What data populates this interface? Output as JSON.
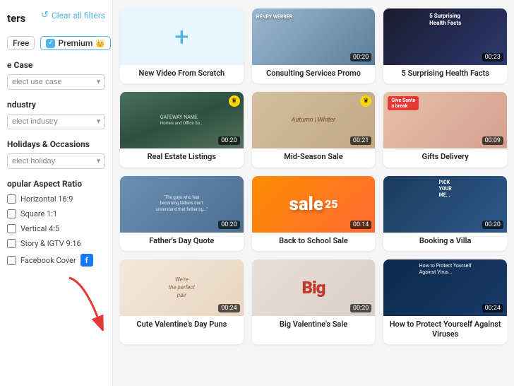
{
  "sidebar": {
    "title": "ters",
    "clear_filters_label": "Clear all filters",
    "free_label": "Free",
    "premium_label": "Premium",
    "use_case_label": "e Case",
    "use_case_placeholder": "elect use case",
    "industry_label": "ndustry",
    "industry_placeholder": "elect industry",
    "holidays_label": "Holidays & Occasions",
    "holidays_placeholder": "elect holiday",
    "aspect_ratio_label": "opular Aspect Ratio",
    "aspect_options": [
      {
        "label": "Horizontal 16:9",
        "id": "h169"
      },
      {
        "label": "Square 1:1",
        "id": "s11"
      },
      {
        "label": "Vertical 4:5",
        "id": "v45"
      },
      {
        "label": "Story & IGTV 9:16",
        "id": "s916"
      },
      {
        "label": "Facebook Cover",
        "id": "fb"
      }
    ]
  },
  "grid": {
    "cards": [
      {
        "id": "new-video",
        "label": "New Video From Scratch",
        "type": "new",
        "duration": null,
        "premium": false
      },
      {
        "id": "consulting",
        "label": "Consulting Services Promo",
        "type": "consulting",
        "duration": "00:20",
        "premium": false
      },
      {
        "id": "health",
        "label": "5 Surprising Health Facts",
        "type": "health",
        "duration": "00:23",
        "premium": false
      },
      {
        "id": "real-estate",
        "label": "Real Estate Listings",
        "type": "real-estate",
        "duration": "00:20",
        "premium": true
      },
      {
        "id": "mid-season",
        "label": "Mid-Season Sale",
        "type": "mid-season",
        "duration": "00:21",
        "premium": true
      },
      {
        "id": "gifts",
        "label": "Gifts Delivery",
        "type": "gifts",
        "duration": "00:09",
        "premium": false
      },
      {
        "id": "fathers",
        "label": "Father's Day Quote",
        "type": "fathers",
        "duration": "00:20",
        "premium": false
      },
      {
        "id": "back-school",
        "label": "Back to School Sale",
        "type": "back-school",
        "duration": "00:14",
        "premium": false
      },
      {
        "id": "villa",
        "label": "Booking a Villa",
        "type": "villa",
        "duration": "00:20",
        "premium": false
      },
      {
        "id": "cute-val",
        "label": "Cute Valentine's Day Puns",
        "type": "cute-val",
        "duration": "00:24",
        "premium": false
      },
      {
        "id": "big-val",
        "label": "Big Valentine's Sale",
        "type": "big-val",
        "duration": "00:20",
        "premium": false
      },
      {
        "id": "protect",
        "label": "How to Protect Yourself Against Viruses",
        "type": "protect",
        "duration": "00:24",
        "premium": false
      }
    ]
  },
  "colors": {
    "accent": "#4db6e8",
    "premium": "#ffd700"
  }
}
